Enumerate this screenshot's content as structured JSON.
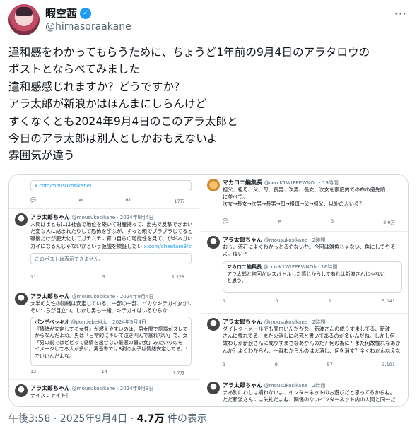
{
  "author": {
    "display_name": "暇空茜",
    "handle": "@himasoraakane",
    "verified_mark": "✓",
    "more_label": "···"
  },
  "tweet": {
    "lines": [
      "違和感をわかってもらうために、ちょうど1年前の9月4日のアラタロウの",
      "ポストとならべてみました",
      "違和感感じれますか？どうですか？",
      "アラ太郎が新浪かはほんまにしらんけど",
      "すくなくとも2024年9月4日のこのアラ太郎と",
      "今日のアラ太郎は別人としかおもえないよ",
      "雰囲気が違う"
    ]
  },
  "media": {
    "left": {
      "top_link": "x.com/mousukosikane/...",
      "top_actions": [
        "61",
        "17万"
      ],
      "post1": {
        "name": "アラ太郎ちゃん",
        "sub": "@mousukosikane · 2024年9月4日",
        "lines": [
          "人間はまともには社会で地位を築いて財産持って、出先で反撃できまいと踏ん",
          "だ変な人に絡まれたりして恐怖を学ぶが、ずっと親でブラブラしてると無",
          "職後だけが肥大化してガチムチに育つ自らの可能性を見て、がギネガいチキ",
          "ガイになるんじゃないかという仮説を検証したい"
        ],
        "link": "x.com/cheetaro3/stat...",
        "unavailable": "このポストは表示できません。",
        "actions": [
          "11",
          "5",
          "5,378"
        ]
      },
      "post2": {
        "name": "アラ太郎ちゃん",
        "sub": "@mousukosikane · 2024年9月4日",
        "lines": [
          "大半の女性の情緒は安定している、一部の一部、バカなキチガイ女がいる。",
          "そいつらが目立つ。しかし男も一緒、キチガイはいるからな"
        ],
        "quote_name": "ボンデベッキオ",
        "quote_sub": "@pondebekkio · 2024年9月4日",
        "quote_lines": [
          "『情緒が安定してる女性』が燃えやすいのは、男女間で認識がズレてる",
          "からなんだよね。男は「日常的にキレて泣き叫んで暴れない」で、女は",
          "「男の前ではピピって感情を出せない最悪の弱い女」みたいなのを",
          "イメージしてる人が多い。男基準では8割の女子は情緒安定してる。普通",
          "でいいんだよな。"
        ],
        "actions": [
          "12",
          "14",
          "1.7万"
        ]
      },
      "post3": {
        "name": "アラ太郎ちゃん",
        "sub": "@mousukosikane · 2024年9月3日",
        "lines": [
          "ナイスファイト！"
        ]
      }
    },
    "right": {
      "post0": {
        "name": "マカロニ編集長",
        "sub": "@rxxcK1WtFEEWNOh · 19時間",
        "lines": [
          "祖父、祖母、父、母、長男、次男、長女、次女を家庭内での命の優先順",
          "に並べて。",
          "次女→長女→次男→長男→母→祖母→父→祖父、以外の人いる？"
        ],
        "actions": [
          "3",
          "3.9万"
        ]
      },
      "post1": {
        "name": "アラ太郎ちゃん",
        "sub": "@mousukosikane · 2時間",
        "lines": [
          "おぅ、流石によくわかっとるやないか。今回は雑魚じゃない、魚にしてやる",
          "よ。偉いぞ"
        ],
        "quote_name": "マカロニ編集長",
        "quote_sub": "@rxxcK1WtFEEWNOh · 16時間",
        "quote_lines": [
          "アラ太郎と何回かレスバトルした感じからしてあれは新浪さんじゃない",
          "と思う。"
        ],
        "actions": [
          "1",
          "1",
          "9",
          "5,041"
        ]
      },
      "post2": {
        "name": "アラ太郎ちゃん",
        "sub": "@mousukosikane · 2時間",
        "lines": [
          "ダイレクトメールでも面白いんだがな、新波さんの成りすましてる、新波",
          "さんに憧れてる、また火消しに必死と書いてあるのが多いんだね。しかし何",
          "故わしが新浪さんに成りすまさなあかんのだ？何の為に？また何故憧れなあか",
          "んか？よくわからん、一番わからんのは火消し、何を消す？全くわかんねえな"
        ],
        "actions": [
          "1",
          "9",
          "57",
          "3,191"
        ]
      },
      "post3": {
        "name": "アラ太郎ちゃん",
        "sub": "@mousukosikane · 2時間",
        "lines": [
          "まあ別にわしは構わないよ、インターネットのお遊びだと思ってるからね。",
          "ただ新波さんには失礼だよね、関係のないインターネット内の人間と同一だ"
        ]
      }
    }
  },
  "meta": {
    "time": "午後3:58 · 2025年9月4日 · ",
    "views": "4.7万",
    "views_suffix": " 件の表示"
  }
}
